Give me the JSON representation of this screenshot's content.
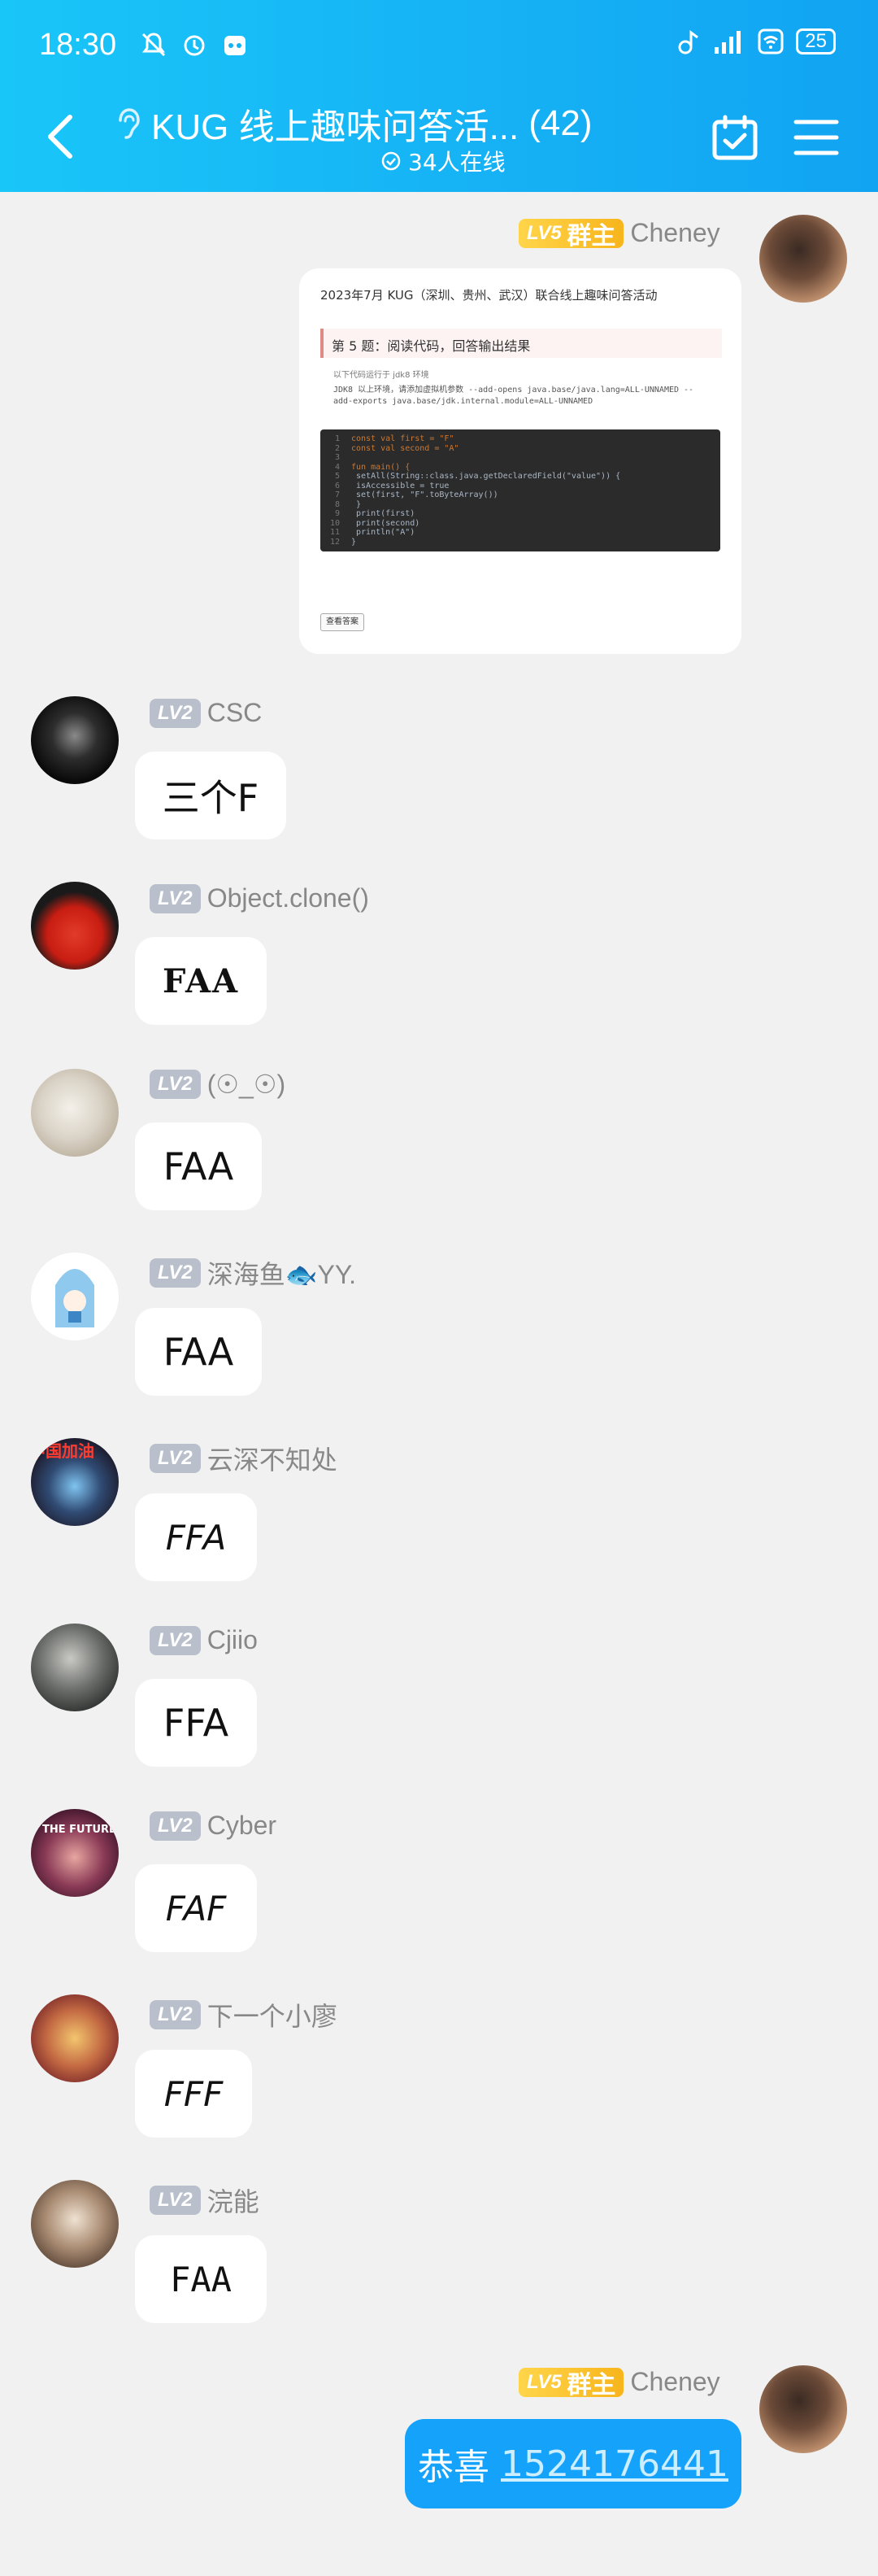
{
  "status_bar": {
    "time": "18:30",
    "battery": "25"
  },
  "header": {
    "title": "KUG 线上趣味问答活...",
    "count": "(42)",
    "online": "34人在线"
  },
  "code_card": {
    "title": "2023年7月 KUG（深圳、贵州、武汉）联合线上趣味问答活动",
    "question": "第 5 题：阅读代码，回答输出结果",
    "note1": "以下代码运行于 jdk8 环境",
    "note2": "JDK8 以上环境，请添加虚拟机参数 --add-opens java.base/java.lang=ALL-UNNAMED --",
    "note3": "add-exports java.base/jdk.internal.module=ALL-UNNAMED",
    "code_lines": [
      {
        "n": "1",
        "t": "const val first = \"F\""
      },
      {
        "n": "2",
        "t": "const val second = \"A\""
      },
      {
        "n": "3",
        "t": ""
      },
      {
        "n": "4",
        "t": "fun main() {"
      },
      {
        "n": "5",
        "t": "    setAll(String::class.java.getDeclaredField(\"value\")) {"
      },
      {
        "n": "6",
        "t": "        isAccessible = true"
      },
      {
        "n": "7",
        "t": "        set(first, \"F\".toByteArray())"
      },
      {
        "n": "8",
        "t": "    }"
      },
      {
        "n": "9",
        "t": "    print(first)"
      },
      {
        "n": "10",
        "t": "    print(second)"
      },
      {
        "n": "11",
        "t": "    println(\"A\")"
      },
      {
        "n": "12",
        "t": "}"
      }
    ],
    "button": "查看答案"
  },
  "messages": [
    {
      "sender": "Cheney",
      "level": "LV5",
      "role": "群主",
      "side": "right"
    },
    {
      "sender": "CSC",
      "level": "LV2",
      "text": "三个F"
    },
    {
      "sender": "Object.clone()",
      "level": "LV2",
      "text": "FAA"
    },
    {
      "sender": "(☉_☉)",
      "level": "LV2",
      "text": "FAA"
    },
    {
      "sender": "深海鱼🐟YY.",
      "level": "LV2",
      "text": "FAA"
    },
    {
      "sender": "云深不知处",
      "level": "LV2",
      "text": "FFA"
    },
    {
      "sender": "Cjiio",
      "level": "LV2",
      "text": "FFA"
    },
    {
      "sender": "Cyber",
      "level": "LV2",
      "text": "FAF"
    },
    {
      "sender": "下一个小廖",
      "level": "LV2",
      "text": "FFF"
    },
    {
      "sender": "浣能",
      "level": "LV2",
      "text": "FAA"
    },
    {
      "sender": "Cheney",
      "level": "LV5",
      "role": "群主",
      "side": "right",
      "text_prefix": "恭喜 ",
      "text_link": "1524176441"
    }
  ],
  "avatar_labels": {
    "cyber": "THE FUTURE",
    "yun": "中国加油"
  },
  "colors": {
    "header": "#16b2f5",
    "bubble_blue": "#15a2fb",
    "lv_gold": "#f8b51c",
    "lv_grey": "#b9bfcb"
  },
  "icons": [
    "back-arrow-icon",
    "ear-icon",
    "calendar-check-icon",
    "menu-icon",
    "verified-check-icon"
  ]
}
